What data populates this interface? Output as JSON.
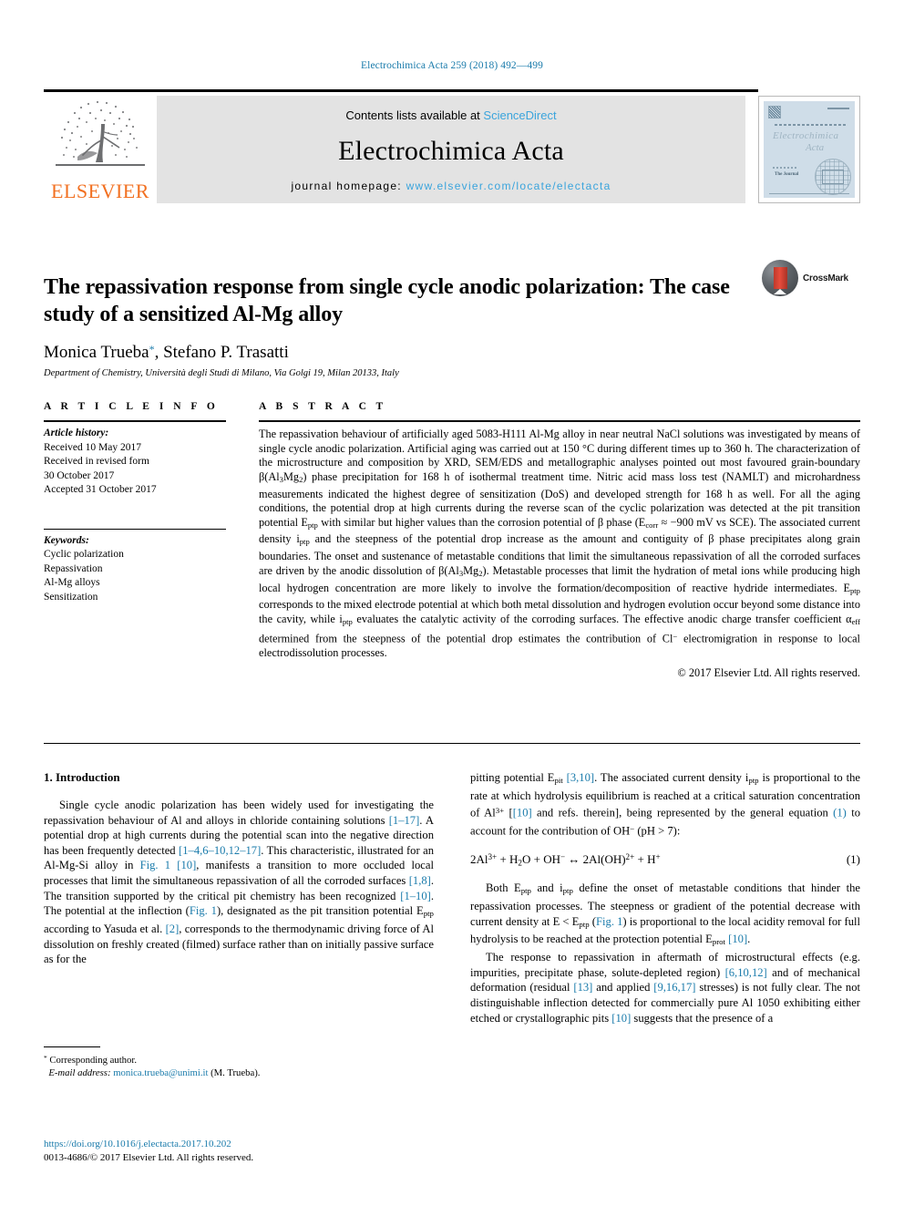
{
  "running_head": "Electrochimica Acta 259 (2018) 492—499",
  "masthead": {
    "contents_prefix": "Contents lists available at ",
    "sciencedirect": "ScienceDirect",
    "journal_title": "Electrochimica Acta",
    "homepage_prefix": "journal homepage: ",
    "homepage_url": "www.elsevier.com/locate/electacta",
    "publisher_logo_text": "ELSEVIER",
    "cover": {
      "journal_name_line1": "Electrochimica",
      "journal_name_line2": "Acta",
      "tagline": "The Journal"
    }
  },
  "article": {
    "title": "The repassivation response from single cycle anodic polarization: The case study of a sensitized Al-Mg alloy",
    "crossmark_label": "CrossMark",
    "authors": "Monica Trueba, Stefano P. Trasatti",
    "corresponding_marker": "*",
    "affiliation": "Department of Chemistry, Università degli Studi di Milano, Via Golgi 19, Milan 20133, Italy"
  },
  "article_info": {
    "heading": "A R T I C L E   I N F O",
    "history_label": "Article history:",
    "history": [
      "Received 10 May 2017",
      "Received in revised form",
      "30 October 2017",
      "Accepted 31 October 2017"
    ],
    "keywords_label": "Keywords:",
    "keywords": [
      "Cyclic polarization",
      "Repassivation",
      "Al-Mg alloys",
      "Sensitization"
    ]
  },
  "abstract": {
    "heading": "A B S T R A C T",
    "paragraph_part1": "The repassivation behaviour of artificially aged 5083-H111 Al-Mg alloy in near neutral NaCl solutions was investigated by means of single cycle anodic polarization. Artificial aging was carried out at 150 °C during different times up to 360 h. The characterization of the microstructure and composition by XRD, SEM/EDS and metallographic analyses pointed out most favoured grain-boundary β(Al",
    "beta_sub1": "3",
    "paragraph_part2": "Mg",
    "beta_sub2": "2",
    "paragraph_part3": ") phase precipitation for 168 h of isothermal treatment time. Nitric acid mass loss test (NAMLT) and microhardness measurements indicated the highest degree of sensitization (DoS) and developed strength for 168 h as well. For all the aging conditions, the potential drop at high currents during the reverse scan of the cyclic polarization was detected at the pit transition potential E",
    "eptp_sub": "ptp",
    "paragraph_part4": " with similar but higher values than the corrosion potential of β phase (E",
    "ecorr_sub": "corr",
    "paragraph_part5": " ≈ −900 mV vs SCE). The associated current density i",
    "iptp_sub": "ptp",
    "paragraph_part6": " and the steepness of the potential drop increase as the amount and contiguity of β phase precipitates along grain boundaries. The onset and sustenance of metastable conditions that limit the simultaneous repassivation of all the corroded surfaces are driven by the anodic dissolution of β(Al",
    "paragraph_part7": "). Metastable processes that limit the hydration of metal ions while producing high local hydrogen concentration are more likely to involve the formation/decomposition of reactive hydride intermediates. E",
    "paragraph_part8": " corresponds to the mixed electrode potential at which both metal dissolution and hydrogen evolution occur beyond some distance into the cavity, while i",
    "paragraph_part9": " evaluates the catalytic activity of the corroding surfaces. The effective anodic charge transfer coefficient α",
    "alpha_sub": "eff",
    "paragraph_part10": " determined from the steepness of the potential drop estimates the contribution of Cl",
    "cl_sup": "−",
    "paragraph_part11": " electromigration in response to local electrodissolution processes.",
    "copyright": "© 2017 Elsevier Ltd. All rights reserved."
  },
  "introduction": {
    "heading": "1. Introduction",
    "left_col": {
      "p1_a": "Single cycle anodic polarization has been widely used for investigating the repassivation behaviour of Al and alloys in chloride containing solutions ",
      "ref1": "[1–17]",
      "p1_b": ". A potential drop at high currents during the potential scan into the negative direction has been frequently detected ",
      "ref2": "[1–4,6–10,12–17]",
      "p1_c": ". This characteristic, illustrated for an Al-Mg-Si alloy in ",
      "ref3": "Fig. 1",
      "p1_d": " ",
      "ref4": "[10]",
      "p1_e": ", manifests a transition to more occluded local processes that limit the simultaneous repassivation of all the corroded surfaces ",
      "ref5": "[1,8]",
      "p1_f": ". The transition supported by the critical pit chemistry has been recognized ",
      "ref6": "[1–10]",
      "p1_g": ". The potential at the inflection (",
      "ref7": "Fig. 1",
      "p1_h": "), designated as the pit transition potential E",
      "sub_ptp": "ptp",
      "p1_i": " according to Yasuda et al. ",
      "ref8": "[2]",
      "p1_j": ", corresponds to the thermodynamic driving force of Al dissolution on freshly created (filmed) surface rather than on initially passive surface as for the"
    },
    "right_col": {
      "p1_a": "pitting potential E",
      "sub_pit": "pit",
      "p1_b": " ",
      "ref1": "[3,10]",
      "p1_c": ". The associated current density i",
      "sub_ptp": "ptp",
      "p1_d": " is proportional to the rate at which hydrolysis equilibrium is reached at a critical saturation concentration of Al",
      "sup_al": "3+",
      "p1_e": " [",
      "ref2": "[10]",
      "p1_f": " and refs. therein], being represented by the general equation ",
      "ref3": "(1)",
      "p1_g": " to account for the contribution of OH",
      "sup_oh": "−",
      "p1_h": " (pH > 7):",
      "equation": "2Al3+ + H2O + OH− ↔ 2Al(OH)2+ + H+",
      "equation_number": "(1)",
      "p2_a": "Both E",
      "p2_sub1": "ptp",
      "p2_b": " and i",
      "p2_sub2": "ptp",
      "p2_c": " define the onset of metastable conditions that hinder the repassivation processes. The steepness or gradient of the potential decrease with current density at E < E",
      "p2_sub3": "ptp",
      "p2_d": " (",
      "ref4": "Fig. 1",
      "p2_e": ") is proportional to the local acidity removal for full hydrolysis to be reached at the protection potential E",
      "p2_sub4": "prot",
      "p2_f": " ",
      "ref5": "[10]",
      "p2_g": ".",
      "p3_a": "The response to repassivation in aftermath of microstructural effects (e.g. impurities, precipitate phase, solute-depleted region) ",
      "ref6": "[6,10,12]",
      "p3_b": " and of mechanical deformation (residual ",
      "ref7": "[13]",
      "p3_c": " and applied ",
      "ref8": "[9,16,17]",
      "p3_d": " stresses) is not fully clear. The not distinguishable inflection detected for commercially pure Al 1050 exhibiting either etched or crystallographic pits ",
      "ref9": "[10]",
      "p3_e": " suggests that the presence of a"
    }
  },
  "footer": {
    "corresponding_marker": "*",
    "corresponding_label": "Corresponding author.",
    "email_label": "E-mail address:",
    "email": "monica.trueba@unimi.it",
    "email_suffix": " (M. Trueba).",
    "doi": "https://doi.org/10.1016/j.electacta.2017.10.202",
    "issn_line": "0013-4686/© 2017 Elsevier Ltd. All rights reserved."
  },
  "colors": {
    "link": "#1a7bab",
    "sciencedirect": "#3aa4dc",
    "elsevier_orange": "#F27021",
    "masthead_bg": "#e3e3e3"
  }
}
